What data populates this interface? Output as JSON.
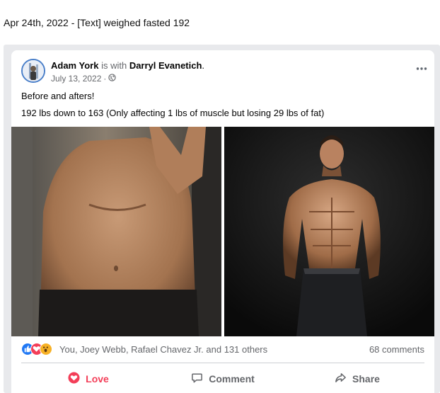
{
  "caption": "Apr 24th, 2022 - [Text] weighed fasted 192",
  "post": {
    "author": "Adam York",
    "with_text": "is with",
    "tagged": "Darryl Evanetich",
    "tagged_suffix": ".",
    "date": "July 13, 2022",
    "date_sep": "·",
    "privacy_icon": "globe-icon",
    "more_icon": "more-options-icon",
    "line1": "Before and afters!",
    "line2": "192 lbs down to 163 (Only affecting 1 lbs of muscle but losing 29 lbs of fat)",
    "photos": [
      {
        "name": "before-photo"
      },
      {
        "name": "after-photo"
      }
    ],
    "reactions": {
      "icons": [
        "like-reaction-icon",
        "love-reaction-icon",
        "wow-reaction-icon"
      ],
      "names": "You, Joey Webb, Rafael Chavez Jr. and 131 others",
      "comments": "68 comments"
    },
    "actions": {
      "love": "Love",
      "comment": "Comment",
      "share": "Share"
    }
  },
  "colors": {
    "accent_love": "#f33e58",
    "like_blue": "#2078f4",
    "wow_yellow": "#f7b125",
    "muted_text": "#65676b"
  }
}
